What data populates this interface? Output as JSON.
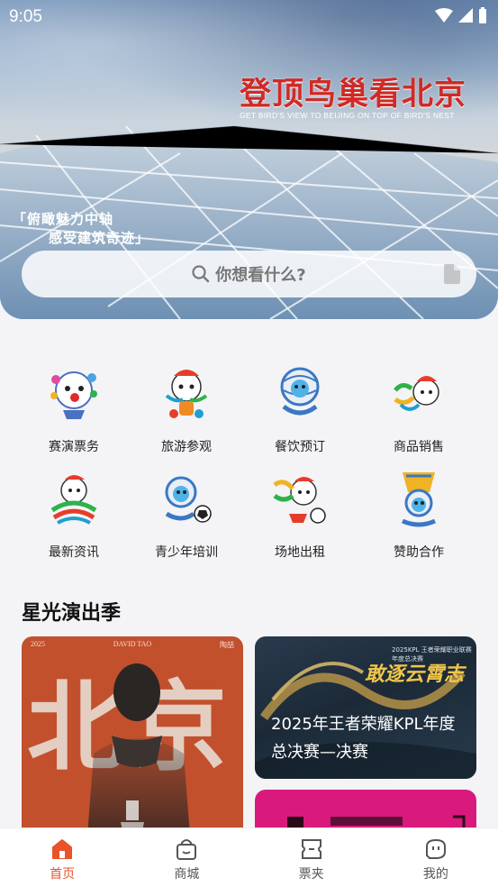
{
  "status_bar": {
    "time": "9:05"
  },
  "hero": {
    "title": "登顶鸟巢看北京",
    "subtitle": "GET BIRD'S VIEW TO BEIJING ON TOP OF BIRD'S NEST",
    "slogan_line1": "「俯瞰魅力中轴",
    "slogan_line2": "感受建筑奇迹」"
  },
  "search": {
    "placeholder": "你想看什么?",
    "icon": "search-icon",
    "right_icon": "document-icon"
  },
  "menu": {
    "items": [
      {
        "label": "赛演票务",
        "icon": "mascot-tickets-icon"
      },
      {
        "label": "旅游参观",
        "icon": "mascot-tour-icon"
      },
      {
        "label": "餐饮预订",
        "icon": "mascot-dining-icon"
      },
      {
        "label": "商品销售",
        "icon": "mascot-merch-icon"
      },
      {
        "label": "最新资讯",
        "icon": "mascot-news-icon"
      },
      {
        "label": "青少年培训",
        "icon": "mascot-youth-training-icon"
      },
      {
        "label": "场地出租",
        "icon": "mascot-venue-rental-icon"
      },
      {
        "label": "赞助合作",
        "icon": "mascot-sponsorship-icon"
      }
    ]
  },
  "section": {
    "title": "星光演出季",
    "cards": [
      {
        "poster_year": "2025",
        "poster_artist": "DAVID TAO",
        "poster_tag": "陶喆",
        "poster_text": "北京"
      },
      {
        "caption": "2025年王者荣耀KPL年度总决赛—决赛",
        "poster_slogan": "敢逐云霄志",
        "poster_top": "2025KPL 王者荣耀职业联赛年度总决赛"
      }
    ]
  },
  "tabbar": {
    "tabs": [
      {
        "label": "首页",
        "icon": "home-icon",
        "active": true
      },
      {
        "label": "商城",
        "icon": "shopping-bag-icon",
        "active": false
      },
      {
        "label": "票夹",
        "icon": "ticket-icon",
        "active": false
      },
      {
        "label": "我的",
        "icon": "profile-icon",
        "active": false
      }
    ],
    "active_color": "#e8532a"
  }
}
